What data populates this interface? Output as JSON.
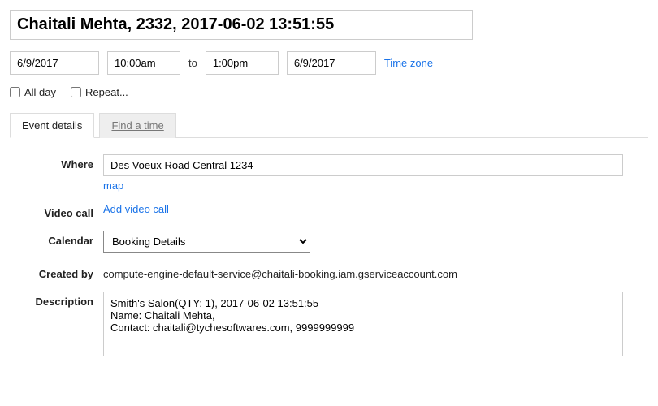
{
  "event": {
    "title": "Chaitali Mehta, 2332, 2017-06-02 13:51:55",
    "start_date": "6/9/2017",
    "start_time": "10:00am",
    "to_label": "to",
    "end_time": "1:00pm",
    "end_date": "6/9/2017",
    "timezone_label": "Time zone",
    "all_day_label": "All day",
    "repeat_label": "Repeat..."
  },
  "tabs": {
    "details": "Event details",
    "find_time": "Find a time"
  },
  "labels": {
    "where": "Where",
    "video_call": "Video call",
    "calendar": "Calendar",
    "created_by": "Created by",
    "description": "Description"
  },
  "fields": {
    "where": "Des Voeux Road Central 1234",
    "map_link": "map",
    "video_call_link": "Add video call",
    "calendar_selected": "Booking Details",
    "created_by": "compute-engine-default-service@chaitali-booking.iam.gserviceaccount.com",
    "description": "Smith's Salon(QTY: 1), 2017-06-02 13:51:55\nName: Chaitali Mehta,\nContact: chaitali@tychesoftwares.com, 9999999999"
  }
}
